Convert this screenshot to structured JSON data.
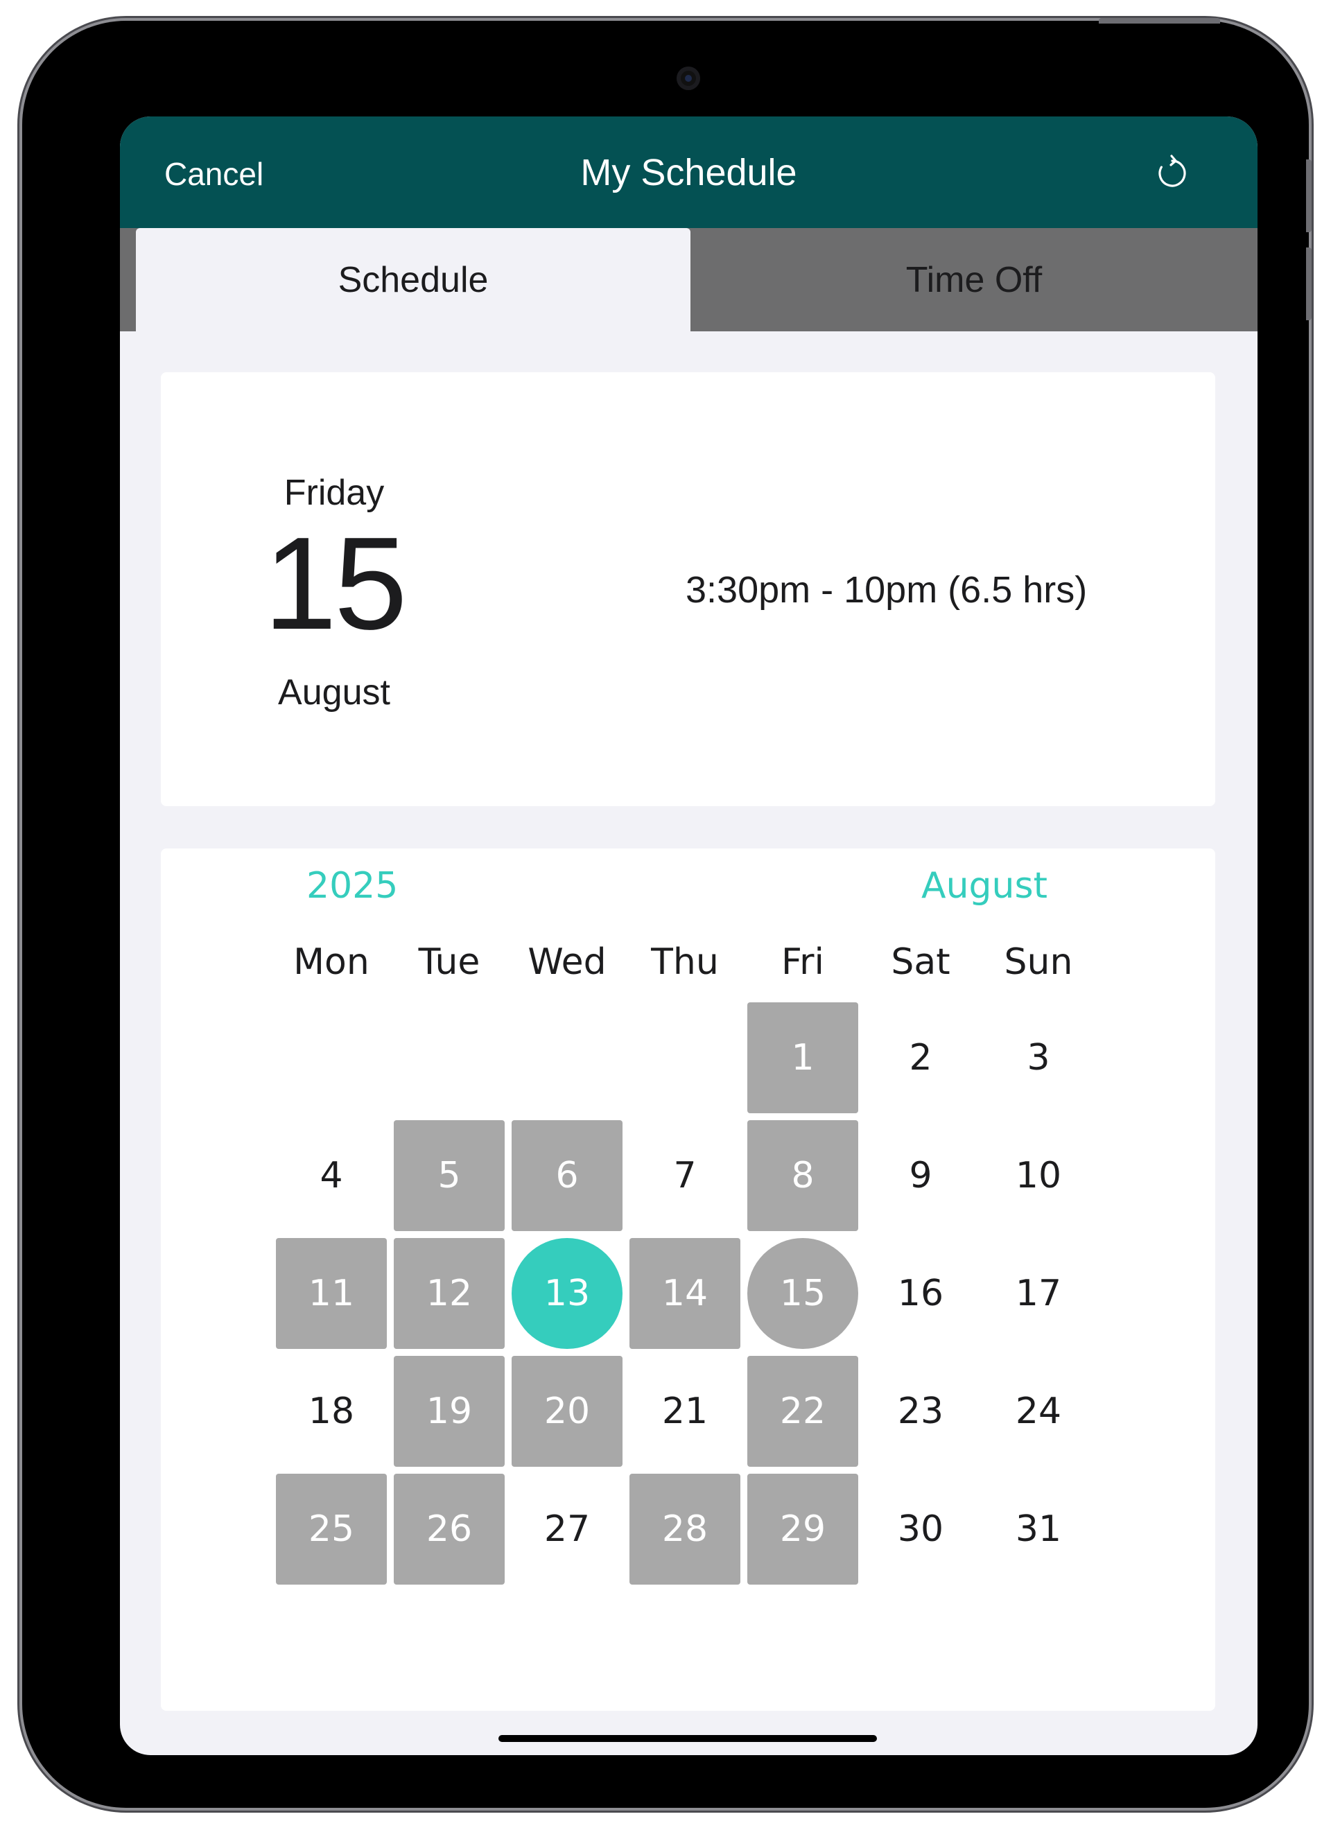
{
  "navbar": {
    "cancel_label": "Cancel",
    "title": "My Schedule",
    "refresh_icon": "refresh-icon",
    "background_color": "#045153"
  },
  "tabs": [
    {
      "label": "Schedule",
      "selected": true
    },
    {
      "label": "Time Off",
      "selected": false
    }
  ],
  "selected_day": {
    "weekday": "Friday",
    "day": "15",
    "month": "August",
    "shift": "3:30pm - 10pm (6.5 hrs)"
  },
  "calendar": {
    "year": "2025",
    "month": "August",
    "accent_color": "#35cdbd",
    "worked_color": "#a8a8a8",
    "weekdays": [
      "Mon",
      "Tue",
      "Wed",
      "Thu",
      "Fri",
      "Sat",
      "Sun"
    ],
    "first_weekday_index": 4,
    "days": [
      {
        "label": "1",
        "state": "worked"
      },
      {
        "label": "2",
        "state": "none"
      },
      {
        "label": "3",
        "state": "none"
      },
      {
        "label": "4",
        "state": "none"
      },
      {
        "label": "5",
        "state": "worked"
      },
      {
        "label": "6",
        "state": "worked"
      },
      {
        "label": "7",
        "state": "none"
      },
      {
        "label": "8",
        "state": "worked"
      },
      {
        "label": "9",
        "state": "none"
      },
      {
        "label": "10",
        "state": "none"
      },
      {
        "label": "11",
        "state": "worked"
      },
      {
        "label": "12",
        "state": "worked"
      },
      {
        "label": "13",
        "state": "today"
      },
      {
        "label": "14",
        "state": "worked"
      },
      {
        "label": "15",
        "state": "selected"
      },
      {
        "label": "16",
        "state": "none"
      },
      {
        "label": "17",
        "state": "none"
      },
      {
        "label": "18",
        "state": "none"
      },
      {
        "label": "19",
        "state": "worked"
      },
      {
        "label": "20",
        "state": "worked"
      },
      {
        "label": "21",
        "state": "none"
      },
      {
        "label": "22",
        "state": "worked"
      },
      {
        "label": "23",
        "state": "none"
      },
      {
        "label": "24",
        "state": "none"
      },
      {
        "label": "25",
        "state": "worked"
      },
      {
        "label": "26",
        "state": "worked"
      },
      {
        "label": "27",
        "state": "none"
      },
      {
        "label": "28",
        "state": "worked"
      },
      {
        "label": "29",
        "state": "worked"
      },
      {
        "label": "30",
        "state": "none"
      },
      {
        "label": "31",
        "state": "none"
      }
    ]
  }
}
